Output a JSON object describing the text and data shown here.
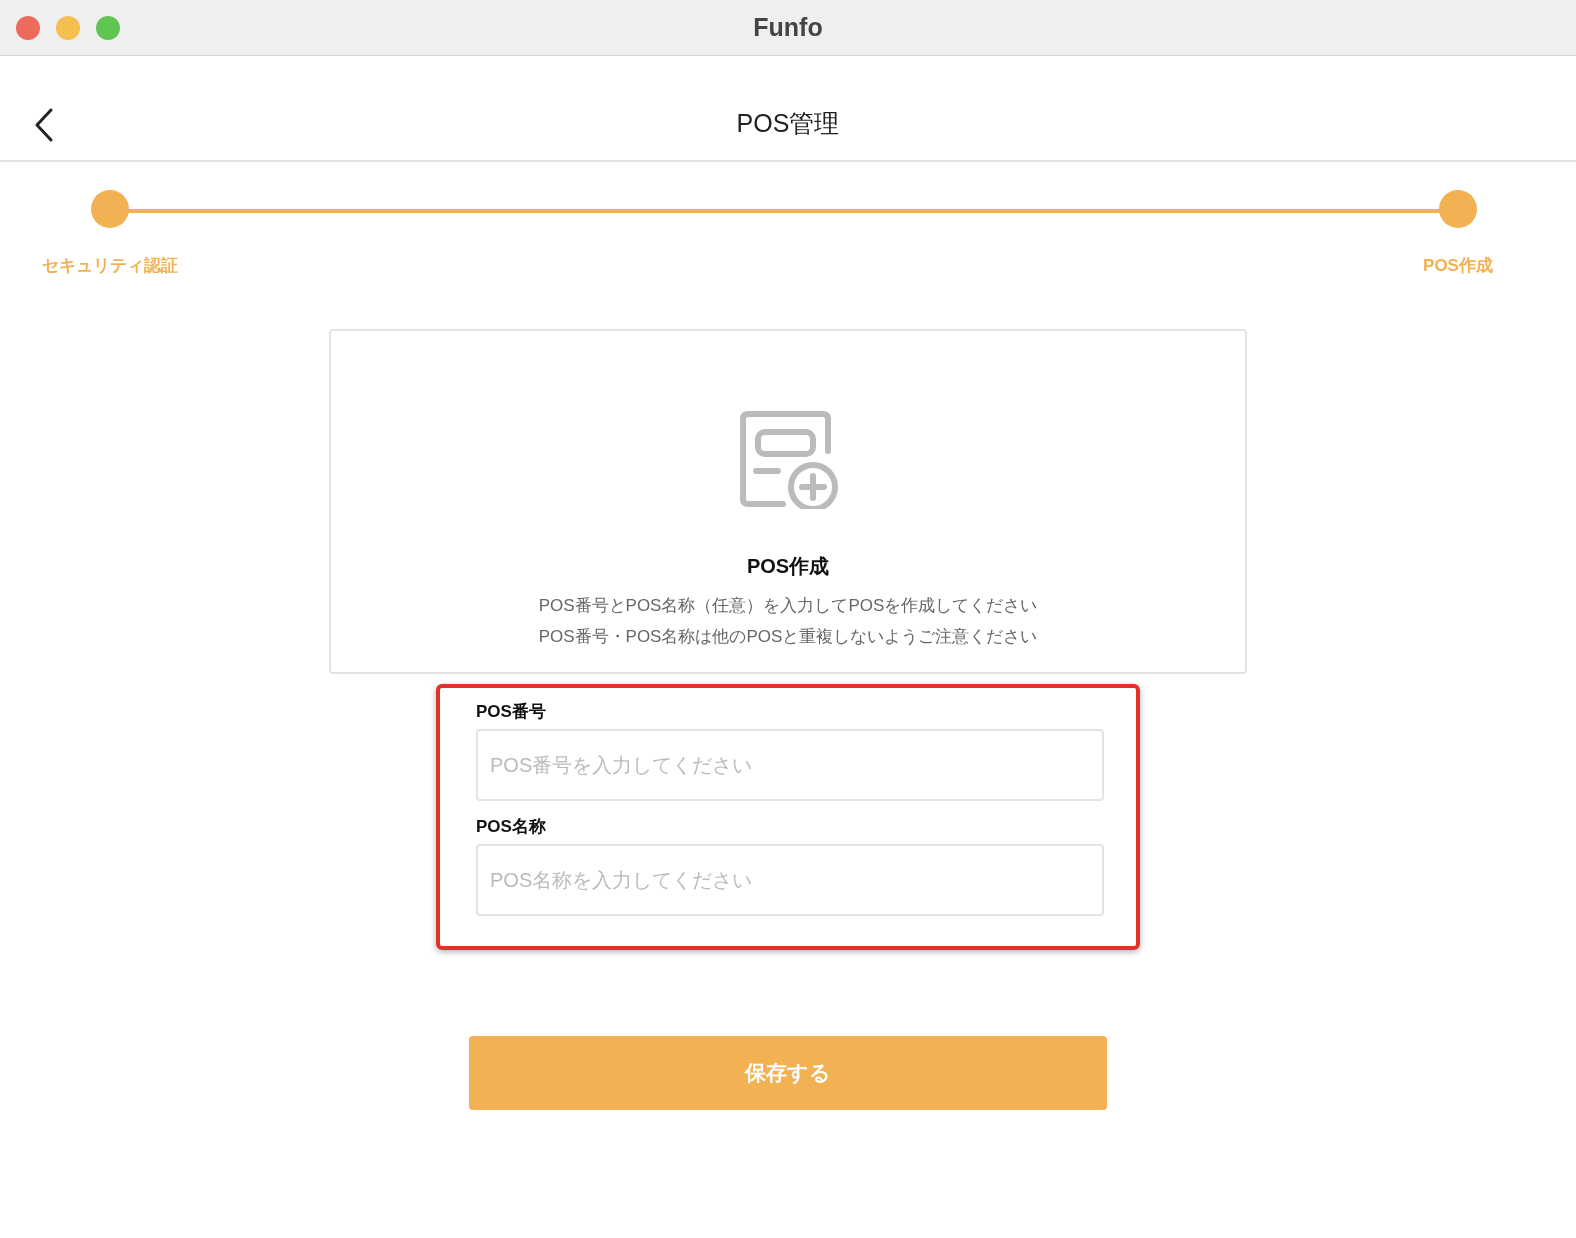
{
  "window": {
    "title": "Funfo"
  },
  "header": {
    "title": "POS管理"
  },
  "steps": [
    {
      "label": "セキュリティ認証",
      "completed": true
    },
    {
      "label": "POS作成",
      "completed": true
    }
  ],
  "intro": {
    "title": "POS作成",
    "lines": [
      "POS番号とPOS名称（任意）を入力してPOSを作成してください",
      "POS番号・POS名称は他のPOSと重複しないようご注意ください"
    ]
  },
  "form": {
    "highlighted": true,
    "fields": [
      {
        "label": "POS番号",
        "placeholder": "POS番号を入力してください"
      },
      {
        "label": "POS名称",
        "placeholder": "POS名称を入力してください"
      }
    ]
  },
  "save_button": {
    "label": "保存する"
  }
}
